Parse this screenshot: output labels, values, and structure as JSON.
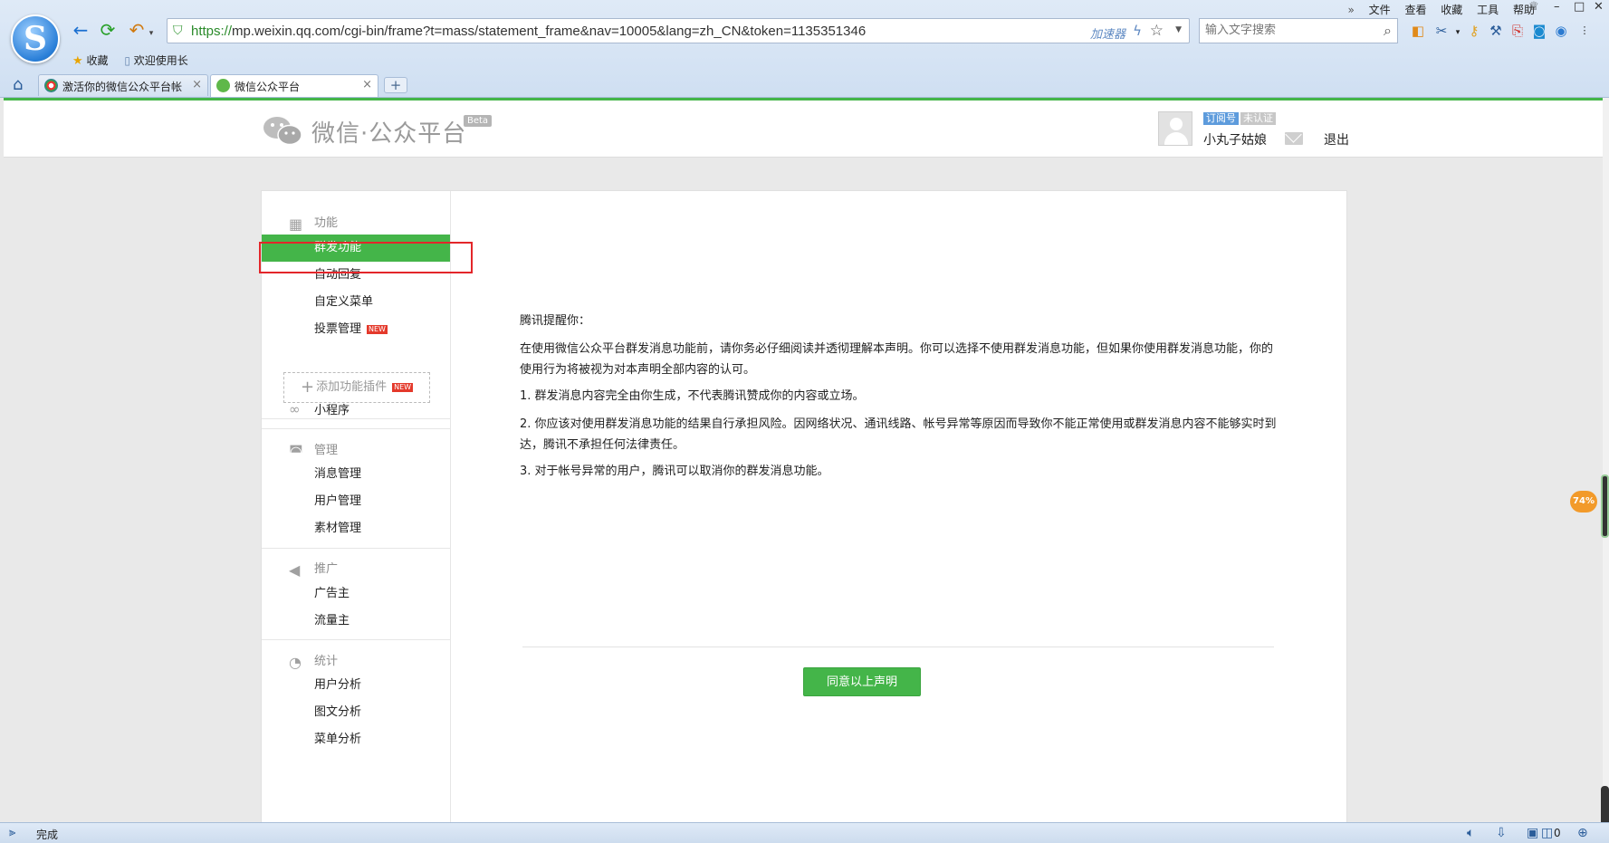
{
  "browser": {
    "url_prefix": "https://",
    "url_rest": "mp.weixin.qq.com/cgi-bin/frame?t=mass/statement_frame&nav=10005&lang=zh_CN&token=1135351346",
    "accelerator": "加速器",
    "search_placeholder": "输入文字搜索",
    "menu": [
      "»",
      "文件",
      "查看",
      "收藏",
      "工具",
      "帮助"
    ],
    "bookmarks": {
      "favorites": "收藏",
      "welcome": "欢迎使用长"
    },
    "tabs": [
      {
        "title": "激活你的微信公众平台帐",
        "close": "×"
      },
      {
        "title": "微信公众平台",
        "close": "×"
      }
    ],
    "newtab": "+",
    "status": "完成",
    "status_count": "0",
    "perf_badge": "74%"
  },
  "header": {
    "brand": "微信·公众平台",
    "beta": "Beta",
    "badge_type": "订阅号",
    "badge_verify": "未认证",
    "username": "小丸子姑娘",
    "logout": "退出"
  },
  "sidebar": {
    "functions": {
      "title": "功能",
      "items": [
        "群发功能",
        "自动回复",
        "自定义菜单",
        "投票管理"
      ],
      "new_tag": "NEW",
      "add_plugin": "添加功能插件"
    },
    "miniprogram": {
      "title": "小程序"
    },
    "manage": {
      "title": "管理",
      "items": [
        "消息管理",
        "用户管理",
        "素材管理"
      ]
    },
    "promote": {
      "title": "推广",
      "items": [
        "广告主",
        "流量主"
      ]
    },
    "stats": {
      "title": "统计",
      "items": [
        "用户分析",
        "图文分析",
        "菜单分析"
      ]
    }
  },
  "statement": {
    "greeting": "腾讯提醒你：",
    "intro": "在使用微信公众平台群发消息功能前，请你务必仔细阅读并透彻理解本声明。你可以选择不使用群发消息功能，但如果你使用群发消息功能，你的使用行为将被视为对本声明全部内容的认可。",
    "p1": "1. 群发消息内容完全由你生成，不代表腾讯赞成你的内容或立场。",
    "p2": "2. 你应该对使用群发消息功能的结果自行承担风险。因网络状况、通讯线路、帐号异常等原因而导致你不能正常使用或群发消息内容不能够实时到达，腾讯不承担任何法律责任。",
    "p3": "3. 对于帐号异常的用户，腾讯可以取消你的群发消息功能。",
    "agree_button": "同意以上声明"
  },
  "colors": {
    "accent": "#44b549",
    "highlight": "#e3262a",
    "chrome": "#dfeaf7"
  }
}
